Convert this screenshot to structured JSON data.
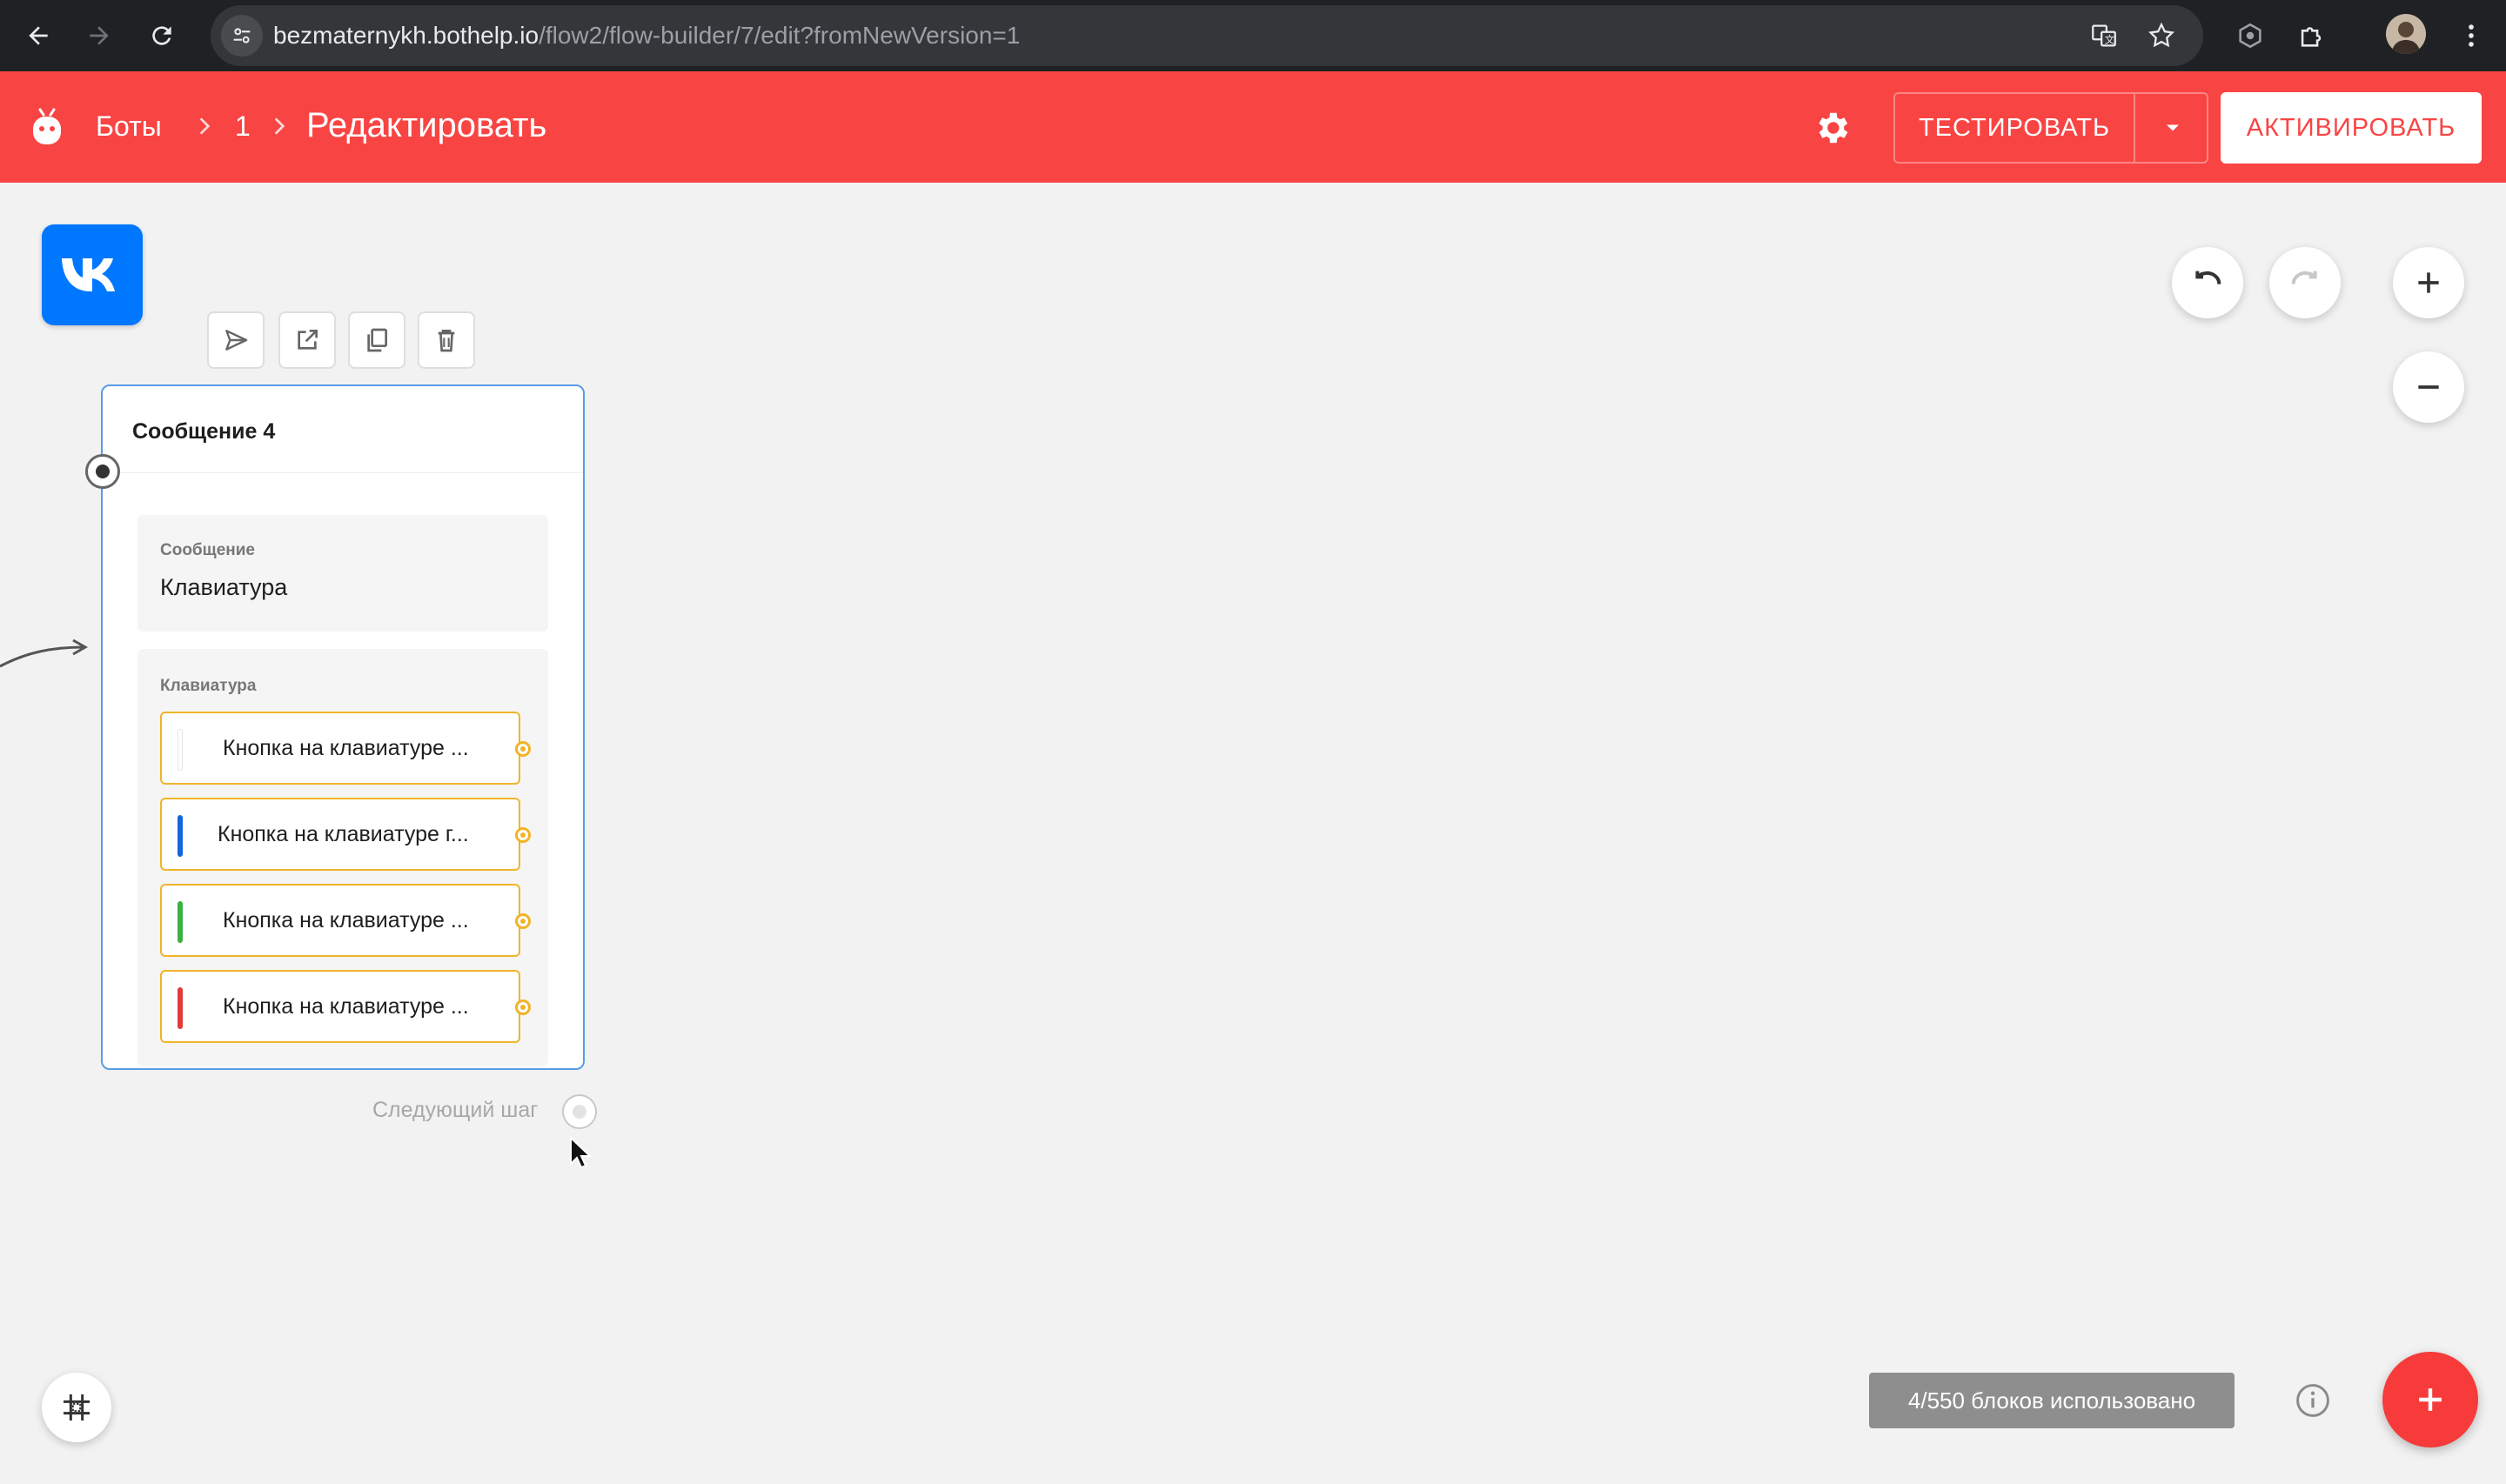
{
  "browser": {
    "url_host": "bezmaternykh.bothelp.io",
    "url_path": "/flow2/flow-builder/7/edit?fromNewVersion=1"
  },
  "header": {
    "breadcrumb_bots": "Боты",
    "breadcrumb_id": "1",
    "page_title": "Редактировать",
    "test_label": "ТЕСТИРОВАТЬ",
    "activate_label": "АКТИВИРОВАТЬ",
    "accent_color": "#f94444"
  },
  "node": {
    "title": "Сообщение 4",
    "message_section": {
      "label": "Сообщение",
      "value": "Клавиатура"
    },
    "keyboard_section": {
      "label": "Клавиатура",
      "buttons": [
        {
          "label": "Кнопка на клавиатуре ...",
          "color": "#ffffff"
        },
        {
          "label": "Кнопка на клавиатуре г...",
          "color": "#1565e0"
        },
        {
          "label": "Кнопка на клавиатуре ...",
          "color": "#3cb043"
        },
        {
          "label": "Кнопка на клавиатуре ...",
          "color": "#e03a3a"
        }
      ]
    },
    "next_step_label": "Следующий шаг"
  },
  "footer": {
    "blocks_used": "4/550 блоков использовано"
  },
  "icons": {
    "toolbar": [
      "send-icon",
      "open-external-icon",
      "copy-icon",
      "trash-icon"
    ],
    "canvas_controls": [
      "undo-icon",
      "redo-icon",
      "zoom-in-icon",
      "zoom-out-icon"
    ]
  }
}
